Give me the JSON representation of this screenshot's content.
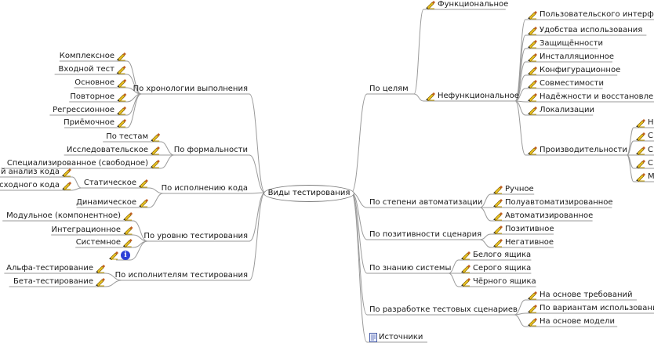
{
  "central": "Виды тестирования",
  "right": [
    {
      "label": "По целям",
      "children": [
        {
          "label": "Функциональное",
          "children": []
        },
        {
          "label": "Нефункциональное",
          "children": [
            {
              "label": "Пользовательского интерфейса"
            },
            {
              "label": "Удобства использования"
            },
            {
              "label": "Защищённости"
            },
            {
              "label": "Инсталляционное"
            },
            {
              "label": "Конфигурационное"
            },
            {
              "label": "Совместимости"
            },
            {
              "label": "Надёжности и восстановления"
            },
            {
              "label": "Локализации"
            },
            {
              "label": "Производительности",
              "children": [
                {
                  "label": "Н"
                },
                {
                  "label": "С"
                },
                {
                  "label": "С"
                },
                {
                  "label": "С"
                },
                {
                  "label": "М"
                }
              ]
            }
          ]
        }
      ]
    },
    {
      "label": "По степени автоматизации",
      "children": [
        {
          "label": "Ручное"
        },
        {
          "label": "Полуавтоматизированное"
        },
        {
          "label": "Автоматизированное"
        }
      ]
    },
    {
      "label": "По позитивности сценария",
      "children": [
        {
          "label": "Позитивное"
        },
        {
          "label": "Негативное"
        }
      ]
    },
    {
      "label": "По знанию системы",
      "children": [
        {
          "label": "Белого ящика"
        },
        {
          "label": "Серого ящика"
        },
        {
          "label": "Чёрного ящика"
        }
      ]
    },
    {
      "label": "По разработке тестовых сценариев",
      "children": [
        {
          "label": "На основе требований"
        },
        {
          "label": "По вариантам использования"
        },
        {
          "label": "На основе модели"
        }
      ]
    },
    {
      "label": "Источники",
      "children": []
    }
  ],
  "left": [
    {
      "label": "По хронологии выполнения",
      "children": [
        {
          "label": "Комплексное"
        },
        {
          "label": "Входной тест"
        },
        {
          "label": "Основное"
        },
        {
          "label": "Повторное"
        },
        {
          "label": "Регрессионное"
        },
        {
          "label": "Приёмочное"
        }
      ]
    },
    {
      "label": "По формальности",
      "children": [
        {
          "label": "По тестам"
        },
        {
          "label": "Исследовательское"
        },
        {
          "label": "Специализированное (свободное)"
        }
      ]
    },
    {
      "label": "По исполнению кода",
      "children": [
        {
          "label": "Статическое",
          "children": [
            {
              "label": "й анализ кода"
            },
            {
              "label": "сходного кода"
            }
          ]
        },
        {
          "label": "Динамическое"
        }
      ]
    },
    {
      "label": "По уровню тестирования",
      "children": [
        {
          "label": "Модульное (компонентное)"
        },
        {
          "label": "Интеграционное"
        },
        {
          "label": "Системное"
        },
        {
          "label": ""
        }
      ]
    },
    {
      "label": "По исполнителям тестирования",
      "children": [
        {
          "label": "Альфа-тестирование"
        },
        {
          "label": "Бета-тестирование"
        }
      ]
    }
  ],
  "icons": {
    "leaf": "pencil-broom-icon",
    "info": "info-icon",
    "sources": "document-icon"
  },
  "colors": {
    "edge": "#9a9a9a",
    "info": "#2c3fd6",
    "pencil": "#e8c020"
  }
}
